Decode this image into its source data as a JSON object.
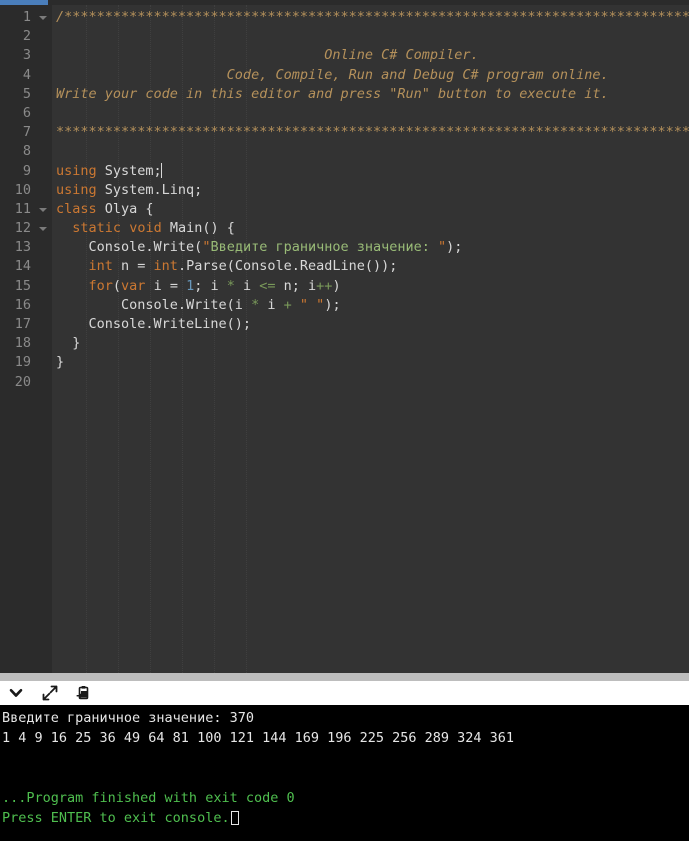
{
  "editor": {
    "theme_bg": "#333333",
    "gutter_bg": "#2b2b2b",
    "accent_scroll": "#4a7ebb",
    "line_numbers": [
      "1",
      "2",
      "3",
      "4",
      "5",
      "6",
      "7",
      "8",
      "9",
      "10",
      "11",
      "12",
      "13",
      "14",
      "15",
      "16",
      "17",
      "18",
      "19",
      "20"
    ],
    "fold_lines": [
      "1",
      "11",
      "12"
    ],
    "lines": [
      {
        "n": "1",
        "tokens": [
          {
            "t": "/********************************************************************************",
            "c": "cmt"
          }
        ]
      },
      {
        "n": "2",
        "tokens": []
      },
      {
        "n": "3",
        "tokens": [
          {
            "t": "                                 Online C# Compiler.",
            "c": "cmt"
          }
        ]
      },
      {
        "n": "4",
        "tokens": [
          {
            "t": "                     Code, Compile, Run and Debug C# program online.",
            "c": "cmt"
          }
        ]
      },
      {
        "n": "5",
        "tokens": [
          {
            "t": "Write your code in this editor and press \"Run\" button to execute it.",
            "c": "cmt"
          }
        ]
      },
      {
        "n": "6",
        "tokens": []
      },
      {
        "n": "7",
        "tokens": [
          {
            "t": "*********************************************************************************",
            "c": "cmt"
          }
        ]
      },
      {
        "n": "8",
        "tokens": []
      },
      {
        "n": "9",
        "tokens": [
          {
            "t": "using",
            "c": "kw"
          },
          {
            "t": " ",
            "c": "plain"
          },
          {
            "t": "System;",
            "c": "plain"
          }
        ],
        "caret_after": true
      },
      {
        "n": "10",
        "tokens": [
          {
            "t": "using",
            "c": "kw"
          },
          {
            "t": " ",
            "c": "plain"
          },
          {
            "t": "System.Linq;",
            "c": "plain"
          }
        ]
      },
      {
        "n": "11",
        "tokens": [
          {
            "t": "class",
            "c": "kw"
          },
          {
            "t": " Olya {",
            "c": "plain"
          }
        ]
      },
      {
        "n": "12",
        "tokens": [
          {
            "t": "  ",
            "c": "plain"
          },
          {
            "t": "static",
            "c": "kw"
          },
          {
            "t": " ",
            "c": "plain"
          },
          {
            "t": "void",
            "c": "kw"
          },
          {
            "t": " Main() {",
            "c": "plain"
          }
        ]
      },
      {
        "n": "13",
        "tokens": [
          {
            "t": "    Console.Write(",
            "c": "plain"
          },
          {
            "t": "\"",
            "c": "strq"
          },
          {
            "t": "Введите граничное значение: ",
            "c": "str"
          },
          {
            "t": "\"",
            "c": "strq"
          },
          {
            "t": ");",
            "c": "plain"
          }
        ]
      },
      {
        "n": "14",
        "tokens": [
          {
            "t": "    ",
            "c": "plain"
          },
          {
            "t": "int",
            "c": "kw"
          },
          {
            "t": " n = ",
            "c": "plain"
          },
          {
            "t": "int",
            "c": "kw"
          },
          {
            "t": ".Parse(Console.ReadLine());",
            "c": "plain"
          }
        ]
      },
      {
        "n": "15",
        "tokens": [
          {
            "t": "    ",
            "c": "plain"
          },
          {
            "t": "for",
            "c": "kw"
          },
          {
            "t": "(",
            "c": "plain"
          },
          {
            "t": "var",
            "c": "kw"
          },
          {
            "t": " i = ",
            "c": "plain"
          },
          {
            "t": "1",
            "c": "num"
          },
          {
            "t": "; i ",
            "c": "plain"
          },
          {
            "t": "*",
            "c": "opg"
          },
          {
            "t": " i ",
            "c": "plain"
          },
          {
            "t": "<=",
            "c": "opg"
          },
          {
            "t": " n; i",
            "c": "plain"
          },
          {
            "t": "++",
            "c": "opg"
          },
          {
            "t": ")",
            "c": "plain"
          }
        ]
      },
      {
        "n": "16",
        "tokens": [
          {
            "t": "        Console.Write(i ",
            "c": "plain"
          },
          {
            "t": "*",
            "c": "opg"
          },
          {
            "t": " i ",
            "c": "plain"
          },
          {
            "t": "+",
            "c": "opg"
          },
          {
            "t": " ",
            "c": "plain"
          },
          {
            "t": "\"",
            "c": "strq"
          },
          {
            "t": " ",
            "c": "str"
          },
          {
            "t": "\"",
            "c": "strq"
          },
          {
            "t": ");",
            "c": "plain"
          }
        ]
      },
      {
        "n": "17",
        "tokens": [
          {
            "t": "    Console.WriteLine();",
            "c": "plain"
          }
        ]
      },
      {
        "n": "18",
        "tokens": [
          {
            "t": "  }",
            "c": "plain"
          }
        ]
      },
      {
        "n": "19",
        "tokens": [
          {
            "t": "}",
            "c": "plain"
          }
        ]
      },
      {
        "n": "20",
        "tokens": []
      }
    ]
  },
  "console_toolbar": {
    "icons": [
      {
        "name": "chevron-down-icon",
        "title": "Collapse console"
      },
      {
        "name": "expand-arrows-icon",
        "title": "Maximize console"
      },
      {
        "name": "clipboard-paste-icon",
        "title": "Copy console output"
      }
    ]
  },
  "console": {
    "bg": "#000000",
    "text_color": "#e6e6e6",
    "status_color": "#4fbf4f",
    "lines": [
      {
        "text": "Введите граничное значение: 370",
        "style": "normal"
      },
      {
        "text": "1 4 9 16 25 36 49 64 81 100 121 144 169 196 225 256 289 324 361",
        "style": "normal"
      },
      {
        "text": "",
        "style": "blank"
      },
      {
        "text": "",
        "style": "blank"
      },
      {
        "text": "...Program finished with exit code 0",
        "style": "green"
      },
      {
        "text": "Press ENTER to exit console.",
        "style": "green",
        "cursor": true
      }
    ]
  }
}
